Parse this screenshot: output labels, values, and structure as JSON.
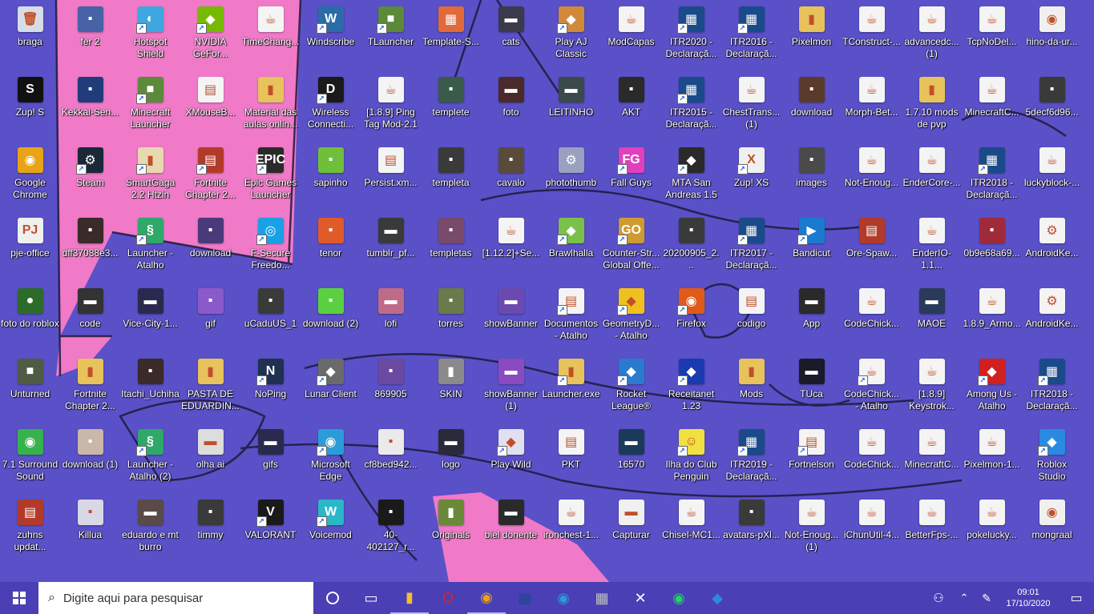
{
  "desktop": {
    "icons": [
      {
        "label": "braga",
        "glyph": "🗑",
        "color": "#d7dde6",
        "shortcut": false
      },
      {
        "label": "Zup! S",
        "glyph": "S",
        "color": "#111111",
        "shortcut": false
      },
      {
        "label": "Google Chrome",
        "glyph": "◉",
        "color": "#e8a316",
        "shortcut": false
      },
      {
        "label": "pje-office",
        "glyph": "PJ",
        "color": "#f0f0f0",
        "shortcut": false
      },
      {
        "label": "foto do roblox",
        "glyph": "●",
        "color": "#2c6b2a",
        "shortcut": false
      },
      {
        "label": "Unturned",
        "glyph": "■",
        "color": "#4f5b43",
        "shortcut": false
      },
      {
        "label": "7.1 Surround Sound",
        "glyph": "◉",
        "color": "#37b24d",
        "shortcut": false
      },
      {
        "label": "zuhns updat...",
        "glyph": "▤",
        "color": "#b23a2a",
        "shortcut": false
      },
      {
        "label": "fer 2",
        "glyph": "▪",
        "color": "#4762a6",
        "shortcut": false
      },
      {
        "label": "Kekkai-Sen...",
        "glyph": "▪",
        "color": "#223b7a",
        "shortcut": false
      },
      {
        "label": "Steam",
        "glyph": "⚙",
        "color": "#1b2838",
        "shortcut": true
      },
      {
        "label": "dff37088e3...",
        "glyph": "▪",
        "color": "#3a2a2a",
        "shortcut": false
      },
      {
        "label": "code",
        "glyph": "▬",
        "color": "#333333",
        "shortcut": false
      },
      {
        "label": "Fortnite Chapter 2...",
        "glyph": "▮",
        "color": "#e8c25a",
        "shortcut": false
      },
      {
        "label": "download (1)",
        "glyph": "▪",
        "color": "#c9b7a9",
        "shortcut": false
      },
      {
        "label": "Killua",
        "glyph": "▪",
        "color": "#d8d8e6",
        "shortcut": false
      },
      {
        "label": "Hotspot Shield",
        "glyph": "◐",
        "color": "#3fa7e0",
        "shortcut": true
      },
      {
        "label": "Minecraft Launcher",
        "glyph": "■",
        "color": "#5c8a3a",
        "shortcut": true
      },
      {
        "label": "SmartGaga 2.2 Htzin",
        "glyph": "▮",
        "color": "#e7d8b0",
        "shortcut": true
      },
      {
        "label": "Launcher - Atalho",
        "glyph": "§",
        "color": "#2fa86a",
        "shortcut": true
      },
      {
        "label": "Vice-City-1...",
        "glyph": "▬",
        "color": "#2a2a50",
        "shortcut": false
      },
      {
        "label": "Itachi_Uchiha",
        "glyph": "▪",
        "color": "#3a2a2a",
        "shortcut": false
      },
      {
        "label": "Launcher - Atalho (2)",
        "glyph": "§",
        "color": "#2fa86a",
        "shortcut": true
      },
      {
        "label": "eduardo e mt burro",
        "glyph": "▬",
        "color": "#5a4a4a",
        "shortcut": false
      },
      {
        "label": "NVIDIA GeFor...",
        "glyph": "◆",
        "color": "#76b900",
        "shortcut": true
      },
      {
        "label": "XMouseB...",
        "glyph": "▤",
        "color": "#f4f4f4",
        "shortcut": false
      },
      {
        "label": "Fortnite Chapter 2...",
        "glyph": "▤",
        "color": "#b23a2a",
        "shortcut": true
      },
      {
        "label": "download",
        "glyph": "▪",
        "color": "#4a3a7a",
        "shortcut": false
      },
      {
        "label": "gif",
        "glyph": "▪",
        "color": "#8a5acb",
        "shortcut": false
      },
      {
        "label": "PASTA DE EDUARDIN...",
        "glyph": "▮",
        "color": "#e8c25a",
        "shortcut": false
      },
      {
        "label": "olha ai",
        "glyph": "▬",
        "color": "#dddddd",
        "shortcut": false
      },
      {
        "label": "timmy",
        "glyph": "▪",
        "color": "#3a3a3a",
        "shortcut": false
      },
      {
        "label": "TimeChang...",
        "glyph": "☕",
        "color": "#f4f4f4",
        "shortcut": false
      },
      {
        "label": "Material das aulas onlin...",
        "glyph": "▮",
        "color": "#e8c25a",
        "shortcut": false
      },
      {
        "label": "Epic Games Launcher",
        "glyph": "EPIC",
        "color": "#2a2a2a",
        "shortcut": true
      },
      {
        "label": "F-Secure Freedo...",
        "glyph": "◎",
        "color": "#19a0e6",
        "shortcut": true
      },
      {
        "label": "uCaduUS_1",
        "glyph": "▪",
        "color": "#3a3a3a",
        "shortcut": false
      },
      {
        "label": "NoPing",
        "glyph": "N",
        "color": "#203050",
        "shortcut": true
      },
      {
        "label": "gifs",
        "glyph": "▬",
        "color": "#2a2a50",
        "shortcut": false
      },
      {
        "label": "VALORANT",
        "glyph": "V",
        "color": "#1a1a1a",
        "shortcut": true
      },
      {
        "label": "Windscribe",
        "glyph": "W",
        "color": "#2a6ca8",
        "shortcut": true
      },
      {
        "label": "Wireless Connecti...",
        "glyph": "D",
        "color": "#1a1a1a",
        "shortcut": true
      },
      {
        "label": "sapinho",
        "glyph": "▪",
        "color": "#6fbf3a",
        "shortcut": false
      },
      {
        "label": "tenor",
        "glyph": "▪",
        "color": "#e05a2a",
        "shortcut": false
      },
      {
        "label": "download (2)",
        "glyph": "▪",
        "color": "#5ad040",
        "shortcut": false
      },
      {
        "label": "Lunar Client",
        "glyph": "◆",
        "color": "#6a6a6a",
        "shortcut": true
      },
      {
        "label": "Microsoft Edge",
        "glyph": "◉",
        "color": "#2a9dd8",
        "shortcut": true
      },
      {
        "label": "Voicemod",
        "glyph": "W",
        "color": "#2ab7c8",
        "shortcut": true
      },
      {
        "label": "TLauncher",
        "glyph": "■",
        "color": "#5c8a3a",
        "shortcut": true
      },
      {
        "label": "[1.8.9] Ping Tag Mod-2.1",
        "glyph": "☕",
        "color": "#f4f4f4",
        "shortcut": false
      },
      {
        "label": "Persist.xm...",
        "glyph": "▤",
        "color": "#f4f4f4",
        "shortcut": false
      },
      {
        "label": "tumblr_pf...",
        "glyph": "▬",
        "color": "#3a3a3a",
        "shortcut": false
      },
      {
        "label": "lofi",
        "glyph": "▬",
        "color": "#c06a8a",
        "shortcut": false
      },
      {
        "label": "869905",
        "glyph": "▪",
        "color": "#6a4aa0",
        "shortcut": false
      },
      {
        "label": "cf8bed942...",
        "glyph": "▪",
        "color": "#eaeaea",
        "shortcut": false
      },
      {
        "label": "40-402127_r...",
        "glyph": "▪",
        "color": "#1a1a1a",
        "shortcut": false
      },
      {
        "label": "Template-S...",
        "glyph": "▦",
        "color": "#e06a3a",
        "shortcut": false
      },
      {
        "label": "templete",
        "glyph": "▪",
        "color": "#3a5a4a",
        "shortcut": false
      },
      {
        "label": "templeta",
        "glyph": "▪",
        "color": "#3a3a3a",
        "shortcut": false
      },
      {
        "label": "templetas",
        "glyph": "▪",
        "color": "#7a4a6a",
        "shortcut": false
      },
      {
        "label": "torres",
        "glyph": "▪",
        "color": "#6a7a4a",
        "shortcut": false
      },
      {
        "label": "SKIN",
        "glyph": "▮",
        "color": "#8a8a8a",
        "shortcut": false
      },
      {
        "label": "logo",
        "glyph": "▬",
        "color": "#2a2a3a",
        "shortcut": false
      },
      {
        "label": "Originals",
        "glyph": "▮",
        "color": "#6a8a3a",
        "shortcut": false
      },
      {
        "label": "cats",
        "glyph": "▬",
        "color": "#3a3a4a",
        "shortcut": false
      },
      {
        "label": "foto",
        "glyph": "▬",
        "color": "#4a2a2a",
        "shortcut": false
      },
      {
        "label": "cavalo",
        "glyph": "▪",
        "color": "#5a4a3a",
        "shortcut": false
      },
      {
        "label": "[1.12.2]+Se...",
        "glyph": "☕",
        "color": "#f4f4f4",
        "shortcut": false
      },
      {
        "label": "showBanner",
        "glyph": "▬",
        "color": "#6a4ab0",
        "shortcut": false
      },
      {
        "label": "showBanner (1)",
        "glyph": "▬",
        "color": "#8a4ac0",
        "shortcut": false
      },
      {
        "label": "Play Wild",
        "glyph": "◆",
        "color": "#e0e0f0",
        "shortcut": true
      },
      {
        "label": "biel donente",
        "glyph": "▬",
        "color": "#2a2a2a",
        "shortcut": false
      },
      {
        "label": "Play AJ Classic",
        "glyph": "◆",
        "color": "#d08a3a",
        "shortcut": true
      },
      {
        "label": "LEITINHO",
        "glyph": "▬",
        "color": "#3a4a4a",
        "shortcut": false
      },
      {
        "label": "photothumb",
        "glyph": "⚙",
        "color": "#9aa0c0",
        "shortcut": false
      },
      {
        "label": "Brawlhalla",
        "glyph": "◆",
        "color": "#7ac04a",
        "shortcut": true
      },
      {
        "label": "Documentos - Atalho",
        "glyph": "▤",
        "color": "#f4f4f4",
        "shortcut": true
      },
      {
        "label": "Launcher.exe",
        "glyph": "▮",
        "color": "#e8c25a",
        "shortcut": true
      },
      {
        "label": "PKT",
        "glyph": "▤",
        "color": "#f4f4f4",
        "shortcut": false
      },
      {
        "label": "ironchest-1...",
        "glyph": "☕",
        "color": "#f4f4f4",
        "shortcut": false
      },
      {
        "label": "ModCapas",
        "glyph": "☕",
        "color": "#f4f4f4",
        "shortcut": false
      },
      {
        "label": "AKT",
        "glyph": "▪",
        "color": "#2a2a2a",
        "shortcut": false
      },
      {
        "label": "Fall Guys",
        "glyph": "FG",
        "color": "#e040c0",
        "shortcut": true
      },
      {
        "label": "Counter-Str... Global Offe...",
        "glyph": "GO",
        "color": "#d09a30",
        "shortcut": true
      },
      {
        "label": "GeometryD... - Atalho",
        "glyph": "◆",
        "color": "#f0c020",
        "shortcut": true
      },
      {
        "label": "Rocket League®",
        "glyph": "◆",
        "color": "#2a7ad0",
        "shortcut": true
      },
      {
        "label": "16570",
        "glyph": "▬",
        "color": "#1a3a5a",
        "shortcut": false
      },
      {
        "label": "Capturar",
        "glyph": "▬",
        "color": "#f0f0f0",
        "shortcut": false
      },
      {
        "label": "ITR2020 - Declaraçã...",
        "glyph": "▦",
        "color": "#1a4a8a",
        "shortcut": true
      },
      {
        "label": "ITR2015 - Declaraçã...",
        "glyph": "▦",
        "color": "#1a4a8a",
        "shortcut": true
      },
      {
        "label": "MTA San Andreas 1.5",
        "glyph": "◆",
        "color": "#2a2a2a",
        "shortcut": true
      },
      {
        "label": "20200905_2...",
        "glyph": "▪",
        "color": "#3a3a3a",
        "shortcut": false
      },
      {
        "label": "Firefox",
        "glyph": "◉",
        "color": "#e05a1a",
        "shortcut": true
      },
      {
        "label": "Receitanet 1.23",
        "glyph": "◆",
        "color": "#1a3ab0",
        "shortcut": true
      },
      {
        "label": "Ilha do Club Penguin",
        "glyph": "☺",
        "color": "#f0e040",
        "shortcut": true
      },
      {
        "label": "Chisel-MC1...",
        "glyph": "☕",
        "color": "#f4f4f4",
        "shortcut": false
      },
      {
        "label": "ITR2016 - Declaraçã...",
        "glyph": "▦",
        "color": "#1a4a8a",
        "shortcut": true
      },
      {
        "label": "ChestTrans... (1)",
        "glyph": "☕",
        "color": "#f4f4f4",
        "shortcut": false
      },
      {
        "label": "Zup! XS",
        "glyph": "X",
        "color": "#f0f0f0",
        "shortcut": true
      },
      {
        "label": "ITR2017 - Declaraçã...",
        "glyph": "▦",
        "color": "#1a4a8a",
        "shortcut": true
      },
      {
        "label": "codigo",
        "glyph": "▤",
        "color": "#f4f4f4",
        "shortcut": false
      },
      {
        "label": "Mods",
        "glyph": "▮",
        "color": "#e8c25a",
        "shortcut": false
      },
      {
        "label": "ITR2019 - Declaraçã...",
        "glyph": "▦",
        "color": "#1a4a8a",
        "shortcut": true
      },
      {
        "label": "avatars-pXl...",
        "glyph": "▪",
        "color": "#3a3a3a",
        "shortcut": false
      },
      {
        "label": "Pixelmon",
        "glyph": "▮",
        "color": "#e8c25a",
        "shortcut": false
      },
      {
        "label": "download",
        "glyph": "▪",
        "color": "#5a3a2a",
        "shortcut": false
      },
      {
        "label": "images",
        "glyph": "▪",
        "color": "#4a4a4a",
        "shortcut": false
      },
      {
        "label": "Bandicut",
        "glyph": "▶",
        "color": "#1a7ad0",
        "shortcut": true
      },
      {
        "label": "App",
        "glyph": "▬",
        "color": "#2a2a2a",
        "shortcut": false
      },
      {
        "label": "TUca",
        "glyph": "▬",
        "color": "#1a1a2a",
        "shortcut": false
      },
      {
        "label": "Fortnelson",
        "glyph": "▤",
        "color": "#f4f4f4",
        "shortcut": true
      },
      {
        "label": "Not-Enoug... (1)",
        "glyph": "☕",
        "color": "#f4f4f4",
        "shortcut": false
      },
      {
        "label": "TConstruct-...",
        "glyph": "☕",
        "color": "#f4f4f4",
        "shortcut": false
      },
      {
        "label": "Morph-Bet...",
        "glyph": "☕",
        "color": "#f4f4f4",
        "shortcut": false
      },
      {
        "label": "Not-Enoug...",
        "glyph": "☕",
        "color": "#f4f4f4",
        "shortcut": false
      },
      {
        "label": "Ore-Spaw...",
        "glyph": "▤",
        "color": "#b23a2a",
        "shortcut": false
      },
      {
        "label": "CodeChick...",
        "glyph": "☕",
        "color": "#f4f4f4",
        "shortcut": false
      },
      {
        "label": "CodeChick... - Atalho",
        "glyph": "☕",
        "color": "#f4f4f4",
        "shortcut": true
      },
      {
        "label": "CodeChick...",
        "glyph": "☕",
        "color": "#f4f4f4",
        "shortcut": false
      },
      {
        "label": "iChunUtil-4...",
        "glyph": "☕",
        "color": "#f4f4f4",
        "shortcut": false
      },
      {
        "label": "advancedc... (1)",
        "glyph": "☕",
        "color": "#f4f4f4",
        "shortcut": false
      },
      {
        "label": "1.7.10 mods de pvp",
        "glyph": "▮",
        "color": "#e8c25a",
        "shortcut": false
      },
      {
        "label": "EnderCore-...",
        "glyph": "☕",
        "color": "#f4f4f4",
        "shortcut": false
      },
      {
        "label": "EnderIO-1.1...",
        "glyph": "☕",
        "color": "#f4f4f4",
        "shortcut": false
      },
      {
        "label": "MAOE",
        "glyph": "▬",
        "color": "#2a3a5a",
        "shortcut": false
      },
      {
        "label": "[1.8.9] Keystrok...",
        "glyph": "☕",
        "color": "#f4f4f4",
        "shortcut": false
      },
      {
        "label": "MinecraftC...",
        "glyph": "☕",
        "color": "#f4f4f4",
        "shortcut": false
      },
      {
        "label": "BetterFps-...",
        "glyph": "☕",
        "color": "#f4f4f4",
        "shortcut": false
      },
      {
        "label": "TcpNoDel...",
        "glyph": "☕",
        "color": "#f4f4f4",
        "shortcut": false
      },
      {
        "label": "MinecraftC...",
        "glyph": "☕",
        "color": "#f4f4f4",
        "shortcut": false
      },
      {
        "label": "ITR2018 - Declaraçã...",
        "glyph": "▦",
        "color": "#1a4a8a",
        "shortcut": true
      },
      {
        "label": "0b9e68a69...",
        "glyph": "▪",
        "color": "#a02a3a",
        "shortcut": false
      },
      {
        "label": "1.8.9_Armo...",
        "glyph": "☕",
        "color": "#f4f4f4",
        "shortcut": false
      },
      {
        "label": "Among Us - Atalho",
        "glyph": "◆",
        "color": "#d02020",
        "shortcut": true
      },
      {
        "label": "Pixelmon-1...",
        "glyph": "☕",
        "color": "#f4f4f4",
        "shortcut": false
      },
      {
        "label": "pokelucky...",
        "glyph": "☕",
        "color": "#f4f4f4",
        "shortcut": false
      },
      {
        "label": "hino-da-ur...",
        "glyph": "◉",
        "color": "#f0f0f0",
        "shortcut": false
      },
      {
        "label": "5decf6d96...",
        "glyph": "▪",
        "color": "#3a3a3a",
        "shortcut": false
      },
      {
        "label": "luckyblock-...",
        "glyph": "☕",
        "color": "#f4f4f4",
        "shortcut": false
      },
      {
        "label": "AndroidKe...",
        "glyph": "⚙",
        "color": "#f4f4f4",
        "shortcut": false
      },
      {
        "label": "AndroidKe...",
        "glyph": "⚙",
        "color": "#f4f4f4",
        "shortcut": false
      },
      {
        "label": "ITR2018 - Declaraçã...",
        "glyph": "▦",
        "color": "#1a4a8a",
        "shortcut": true
      },
      {
        "label": "Roblox Studio",
        "glyph": "◆",
        "color": "#2a8ae0",
        "shortcut": true
      },
      {
        "label": "mongraal",
        "glyph": "◉",
        "color": "#f0f0f0",
        "shortcut": false
      }
    ]
  },
  "taskbar": {
    "search_placeholder": "Digite aqui para pesquisar",
    "pinned": [
      {
        "name": "task-view",
        "glyph": "▭",
        "color": "#ffffff",
        "active": false
      },
      {
        "name": "file-explorer",
        "glyph": "▮",
        "color": "#f0c030",
        "active": true
      },
      {
        "name": "opera",
        "glyph": "O",
        "color": "#e02020",
        "active": false
      },
      {
        "name": "chrome",
        "glyph": "◉",
        "color": "#e8a316",
        "active": true
      },
      {
        "name": "receita",
        "glyph": "▦",
        "color": "#1a4a8a",
        "active": false
      },
      {
        "name": "edge",
        "glyph": "◉",
        "color": "#2a9dd8",
        "active": false
      },
      {
        "name": "app",
        "glyph": "▦",
        "color": "#c0c0c0",
        "active": false
      },
      {
        "name": "xbox",
        "glyph": "✕",
        "color": "#ffffff",
        "active": false
      },
      {
        "name": "spotify",
        "glyph": "◉",
        "color": "#1ed760",
        "active": false
      },
      {
        "name": "roblox",
        "glyph": "◆",
        "color": "#2a8ae0",
        "active": false
      }
    ],
    "clock": {
      "time": "09:01",
      "date": "17/10/2020"
    }
  }
}
